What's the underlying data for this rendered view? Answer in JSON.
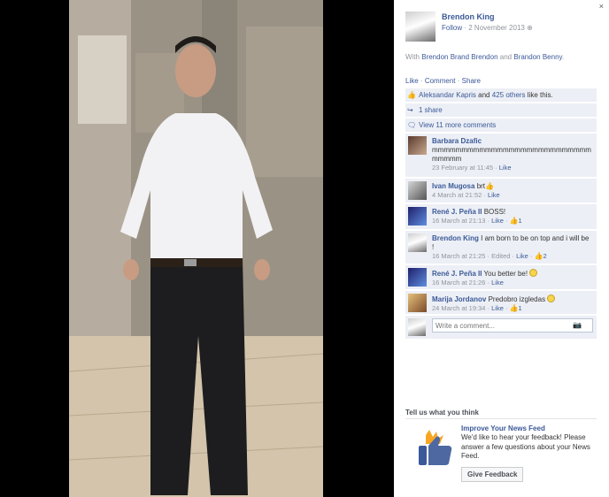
{
  "post": {
    "author": "Brendon King",
    "follow": "Follow",
    "date": "2 November 2013",
    "with_prefix": "With",
    "tag_1": "Brendon Brand Brendon",
    "and": "and",
    "tag_2": "Brandon Benny",
    "tag_end": "."
  },
  "actions": {
    "like": "Like",
    "comment": "Comment",
    "share": "Share"
  },
  "ufi": {
    "likers": "Aleksandar Kapris",
    "likers_and": "and",
    "likers_others": "425 others",
    "likers_suffix": "like this.",
    "shares": "1 share",
    "view_more": "View 11 more comments"
  },
  "comments": [
    {
      "name": "Barbara Dzafic",
      "text": "mmmmmmmmmmmmmmmmmmmmmmmmmmmmmmmm",
      "time": "23 February at 11:45",
      "like": "Like",
      "likes": ""
    },
    {
      "name": "Ivan Mugosa",
      "text": "brt",
      "time": "4 March at 21:52",
      "like": "Like",
      "likes": ""
    },
    {
      "name": "René J. Peña II",
      "text": "BOSS!",
      "time": "16 March at 21:13",
      "like": "Like",
      "likes": "1"
    },
    {
      "name": "Brendon King",
      "text": "I am born to be on top and i will be !",
      "time": "16 March at 21:25",
      "edited": "Edited",
      "like": "Like",
      "likes": "2"
    },
    {
      "name": "René J. Peña II",
      "text": "You better be!",
      "time": "16 March at 21:26",
      "like": "Like",
      "likes": ""
    },
    {
      "name": "Marija Jordanov",
      "text": "Predobro izgledas",
      "time": "24 March at 19:34",
      "like": "Like",
      "likes": "1"
    }
  ],
  "write_placeholder": "Write a comment...",
  "feedback": {
    "header": "Tell us what you think",
    "title": "Improve Your News Feed",
    "text": "We'd like to hear your feedback! Please answer a few questions about your News Feed.",
    "button": "Give Feedback"
  },
  "close": "×",
  "colors": {
    "link": "#3b5998",
    "meta": "#90949c",
    "ufi_bg": "#eceff5"
  }
}
